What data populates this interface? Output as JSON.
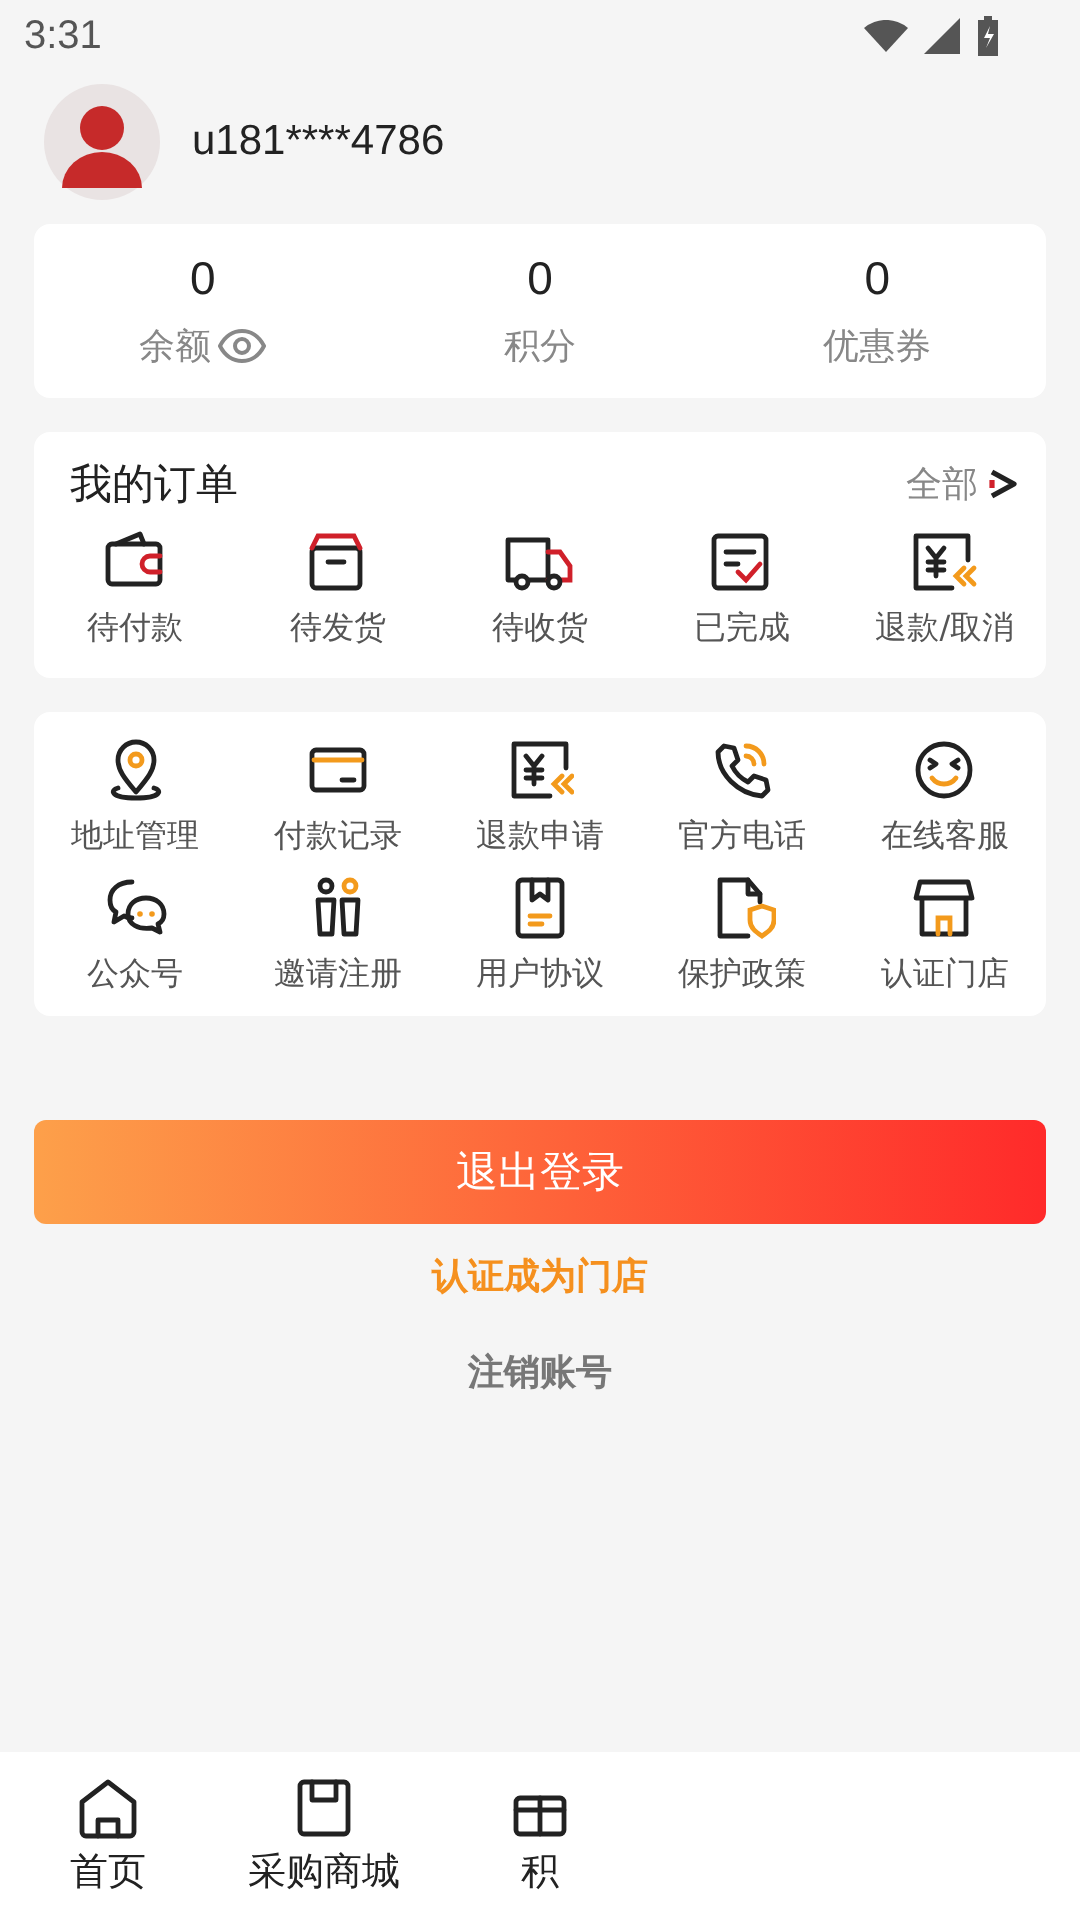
{
  "status_bar": {
    "time": "3:31"
  },
  "profile": {
    "username": "u181****4786"
  },
  "stats": [
    {
      "value": "0",
      "label": "余额",
      "eye": true
    },
    {
      "value": "0",
      "label": "积分",
      "eye": false
    },
    {
      "value": "0",
      "label": "优惠券",
      "eye": false
    }
  ],
  "orders": {
    "title": "我的订单",
    "all_link": "全部",
    "items": [
      "待付款",
      "待发货",
      "待收货",
      "已完成",
      "退款/取消"
    ]
  },
  "services": [
    "地址管理",
    "付款记录",
    "退款申请",
    "官方电话",
    "在线客服",
    "公众号",
    "邀请注册",
    "用户协议",
    "保护政策",
    "认证门店"
  ],
  "logout_button": "退出登录",
  "certify_link": "认证成为门店",
  "cancel_account_link": "注销账号",
  "bottom_nav": [
    {
      "label": "首页"
    },
    {
      "label": "采购商城"
    },
    {
      "label": "积"
    }
  ]
}
